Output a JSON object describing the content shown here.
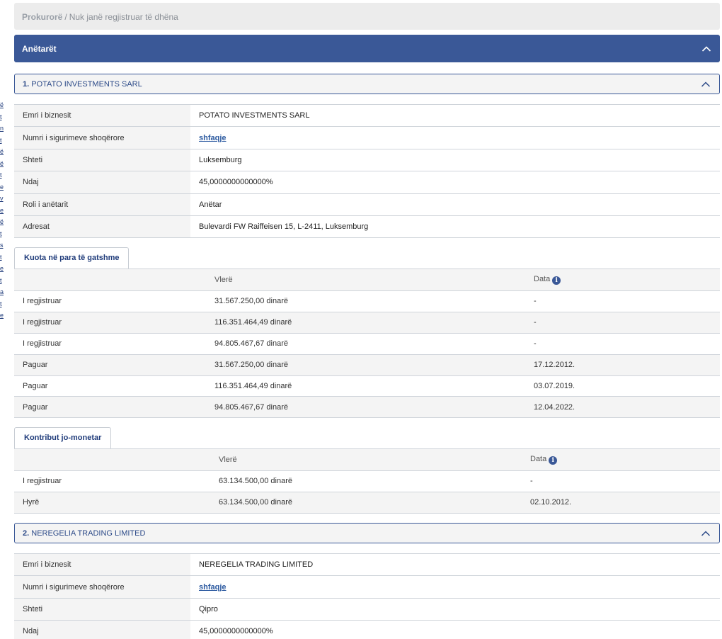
{
  "breadcrumb": {
    "first": "Prokurorë",
    "separator": "/",
    "current": "Nuk janë regjistruar të dhëna"
  },
  "side_fragments": [
    "ë",
    "t",
    "n",
    "t",
    "ë",
    "ë",
    "t",
    "e",
    "v",
    "e",
    "ë",
    "t",
    "s",
    "t",
    "e",
    "t",
    "a",
    "t",
    "e"
  ],
  "section": {
    "title": "Anëtarët"
  },
  "members": [
    {
      "number": "1.",
      "name": "POTATO INVESTMENTS SARL",
      "fields": [
        {
          "label": "Emri i biznesit",
          "value": "POTATO INVESTMENTS SARL"
        },
        {
          "label": "Numri i sigurimeve shoqërore",
          "value": "shfaqje"
        },
        {
          "label": "Shteti",
          "value": "Luksemburg"
        },
        {
          "label": "Ndaj",
          "value": "45,0000000000000%"
        },
        {
          "label": "Roli i anëtarit",
          "value": "Anëtar"
        },
        {
          "label": "Adresat",
          "value": "Bulevardi FW Raiffeisen 15, L-2411, Luksemburg"
        }
      ],
      "cash_tab": "Kuota në para të gatshme",
      "cash_headers": {
        "value": "Vlerë",
        "date": "Data"
      },
      "cash_rows": [
        {
          "type": "I regjistruar",
          "value": "31.567.250,00 dinarë",
          "date": "-"
        },
        {
          "type": "I regjistruar",
          "value": "116.351.464,49 dinarë",
          "date": "-"
        },
        {
          "type": "I regjistruar",
          "value": "94.805.467,67 dinarë",
          "date": "-"
        },
        {
          "type": "Paguar",
          "value": "31.567.250,00 dinarë",
          "date": "17.12.2012."
        },
        {
          "type": "Paguar",
          "value": "116.351.464,49 dinarë",
          "date": "03.07.2019."
        },
        {
          "type": "Paguar",
          "value": "94.805.467,67 dinarë",
          "date": "12.04.2022."
        }
      ],
      "noncash_tab": "Kontribut jo-monetar",
      "noncash_headers": {
        "value": "Vlerë",
        "date": "Data"
      },
      "noncash_rows": [
        {
          "type": "I regjistruar",
          "value": "63.134.500,00 dinarë",
          "date": "-"
        },
        {
          "type": "Hyrë",
          "value": "63.134.500,00 dinarë",
          "date": "02.10.2012."
        }
      ]
    },
    {
      "number": "2.",
      "name": "NEREGELIA TRADING LIMITED",
      "fields": [
        {
          "label": "Emri i biznesit",
          "value": "NEREGELIA TRADING LIMITED"
        },
        {
          "label": "Numri i sigurimeve shoqërore",
          "value": "shfaqje"
        },
        {
          "label": "Shteti",
          "value": "Qipro"
        },
        {
          "label": "Ndaj",
          "value": "45,0000000000000%"
        }
      ]
    }
  ],
  "info_icon_glyph": "i",
  "colors": {
    "accent": "#3a5897",
    "link": "#2c5aa0",
    "header_bg": "#f4f4f4"
  }
}
